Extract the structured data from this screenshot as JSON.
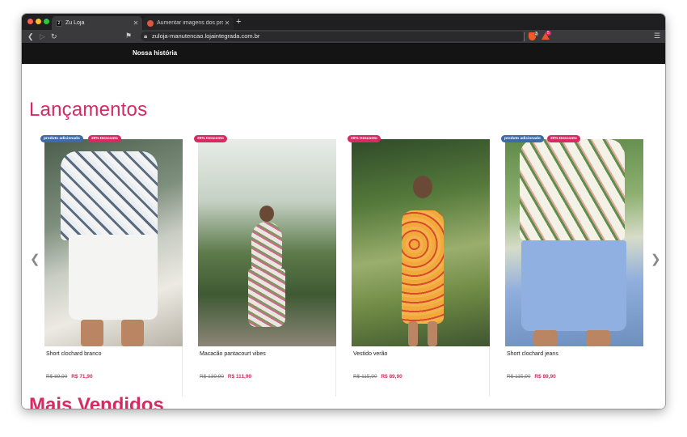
{
  "browser": {
    "tabs": [
      {
        "title": "Zu Loja",
        "favicon": "store-favicon"
      },
      {
        "title": "Aumentar imagens dos produtos",
        "favicon": "loja-integrada-favicon"
      }
    ],
    "new_tab": "+",
    "url": "zuloja-manutencao.lojaintegrada.com.br",
    "brave_badge": "3",
    "rewards_badge": "5"
  },
  "site": {
    "nav_link": "Nossa história"
  },
  "sections": {
    "launches_title": "Lançamentos",
    "best_sellers_title": "Mais Vendidos"
  },
  "products": [
    {
      "name": "Short clochard branco",
      "badges": [
        "produto adicionado",
        "20% Desconto"
      ],
      "old_price": "R$ 89,90",
      "price": "R$ 71,90"
    },
    {
      "name": "Macacão pantacourt vibes",
      "badges": [
        "20% Desconto"
      ],
      "old_price": "R$ 139,90",
      "price": "R$ 111,90"
    },
    {
      "name": "Vestido verão",
      "badges": [
        "20% Desconto"
      ],
      "old_price": "R$ 115,90",
      "price": "R$ 89,90"
    },
    {
      "name": "Short clochard jeans",
      "badges": [
        "produto adicionado",
        "20% Desconto"
      ],
      "old_price": "R$ 115,90",
      "price": "R$ 89,90"
    }
  ],
  "colors": {
    "accent": "#d62a62",
    "badge_blue": "#3d6aa8",
    "header_bg": "#141414"
  }
}
